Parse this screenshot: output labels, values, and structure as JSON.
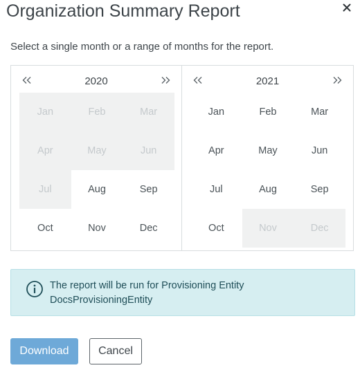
{
  "dialog": {
    "title": "Organization Summary Report",
    "close_icon": "close-icon",
    "instructions": "Select a single month or a range of months for the report."
  },
  "picker": {
    "prev_glyph": "<<",
    "next_glyph": ">>",
    "left": {
      "year": "2020",
      "months": [
        {
          "label": "Jan",
          "disabled": true
        },
        {
          "label": "Feb",
          "disabled": true
        },
        {
          "label": "Mar",
          "disabled": true
        },
        {
          "label": "Apr",
          "disabled": true
        },
        {
          "label": "May",
          "disabled": true
        },
        {
          "label": "Jun",
          "disabled": true
        },
        {
          "label": "Jul",
          "disabled": true
        },
        {
          "label": "Aug",
          "disabled": false
        },
        {
          "label": "Sep",
          "disabled": false
        },
        {
          "label": "Oct",
          "disabled": false
        },
        {
          "label": "Nov",
          "disabled": false
        },
        {
          "label": "Dec",
          "disabled": false
        }
      ]
    },
    "right": {
      "year": "2021",
      "months": [
        {
          "label": "Jan",
          "disabled": false
        },
        {
          "label": "Feb",
          "disabled": false
        },
        {
          "label": "Mar",
          "disabled": false
        },
        {
          "label": "Apr",
          "disabled": false
        },
        {
          "label": "May",
          "disabled": false
        },
        {
          "label": "Jun",
          "disabled": false
        },
        {
          "label": "Jul",
          "disabled": false
        },
        {
          "label": "Aug",
          "disabled": false
        },
        {
          "label": "Sep",
          "disabled": false
        },
        {
          "label": "Oct",
          "disabled": false
        },
        {
          "label": "Nov",
          "disabled": true
        },
        {
          "label": "Dec",
          "disabled": true
        }
      ]
    }
  },
  "info": {
    "icon": "info-icon",
    "line1": "The report will be run for Provisioning Entity",
    "line2": "DocsProvisioningEntity"
  },
  "actions": {
    "download_label": "Download",
    "cancel_label": "Cancel"
  },
  "colors": {
    "primary_button": "#6ea9d8",
    "info_background": "#d6eef1",
    "disabled_month_background": "#f0f1f1"
  }
}
